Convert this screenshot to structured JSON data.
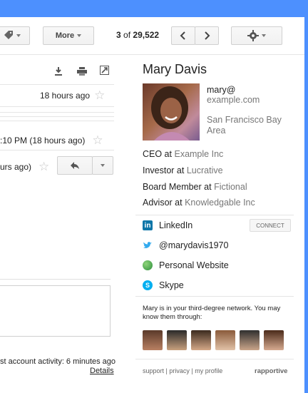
{
  "toolbar": {
    "more_label": "More",
    "page_current": "3",
    "page_of": "of",
    "page_total": "29,522"
  },
  "email": {
    "time1": "18 hours ago",
    "time2": ":10 PM (18 hours ago)",
    "time3": "urs ago)",
    "activity": "st account activity: 6 minutes ago",
    "details": "Details"
  },
  "contact": {
    "name": "Mary Davis",
    "email_line1": "mary@",
    "email_line2": "example.com",
    "location_line1": "San Francisco Bay",
    "location_line2": "Area",
    "roles": [
      {
        "title": "CEO at",
        "company": "Example Inc"
      },
      {
        "title": "Investor at",
        "company": "Lucrative"
      },
      {
        "title": "Board Member at",
        "company": "Fictional"
      },
      {
        "title": "Advisor at",
        "company": "Knowledgable Inc"
      }
    ],
    "social": [
      {
        "label": "LinkedIn",
        "icon": "linkedin-icon"
      },
      {
        "label": "@marydavis1970",
        "icon": "twitter-icon"
      },
      {
        "label": "Personal Website",
        "icon": "globe-icon"
      },
      {
        "label": "Skype",
        "icon": "skype-icon"
      }
    ],
    "connect_label": "CONNECT",
    "network_text": "Mary is in your third-degree network. You may know them through:",
    "footer_support": "support",
    "footer_privacy": "privacy",
    "footer_profile": "my profile",
    "brand": "rapportive"
  },
  "colors": {
    "accent": "#4d90fe",
    "link_gray": "#777777"
  }
}
